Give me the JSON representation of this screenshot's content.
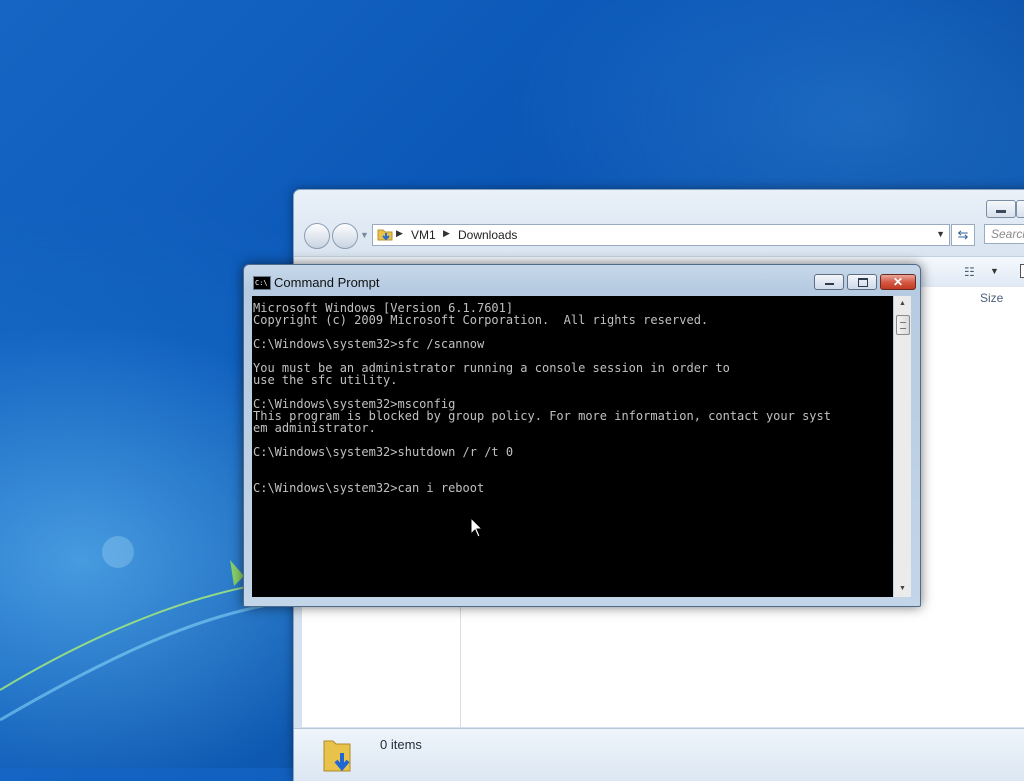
{
  "desktop": {
    "wallpaper": "Windows 7 default"
  },
  "explorer": {
    "breadcrumb": [
      "VM1",
      "Downloads"
    ],
    "search_placeholder": "Search",
    "column_headers": [
      "Size"
    ],
    "status": {
      "items_count": "0 items"
    }
  },
  "cmd": {
    "title": "Command Prompt",
    "icon_label": "C:\\",
    "lines": [
      "Microsoft Windows [Version 6.1.7601]",
      "Copyright (c) 2009 Microsoft Corporation.  All rights reserved.",
      "",
      "C:\\Windows\\system32>sfc /scannow",
      "",
      "You must be an administrator running a console session in order to",
      "use the sfc utility.",
      "",
      "C:\\Windows\\system32>msconfig",
      "This program is blocked by group policy. For more information, contact your syst",
      "em administrator.",
      "",
      "C:\\Windows\\system32>shutdown /r /t 0",
      "",
      "",
      "C:\\Windows\\system32>can i reboot"
    ],
    "close_glyph": "✕"
  },
  "colors": {
    "console_bg": "#000000",
    "console_text": "#c0c0c0",
    "close_button": "#c03a22"
  }
}
